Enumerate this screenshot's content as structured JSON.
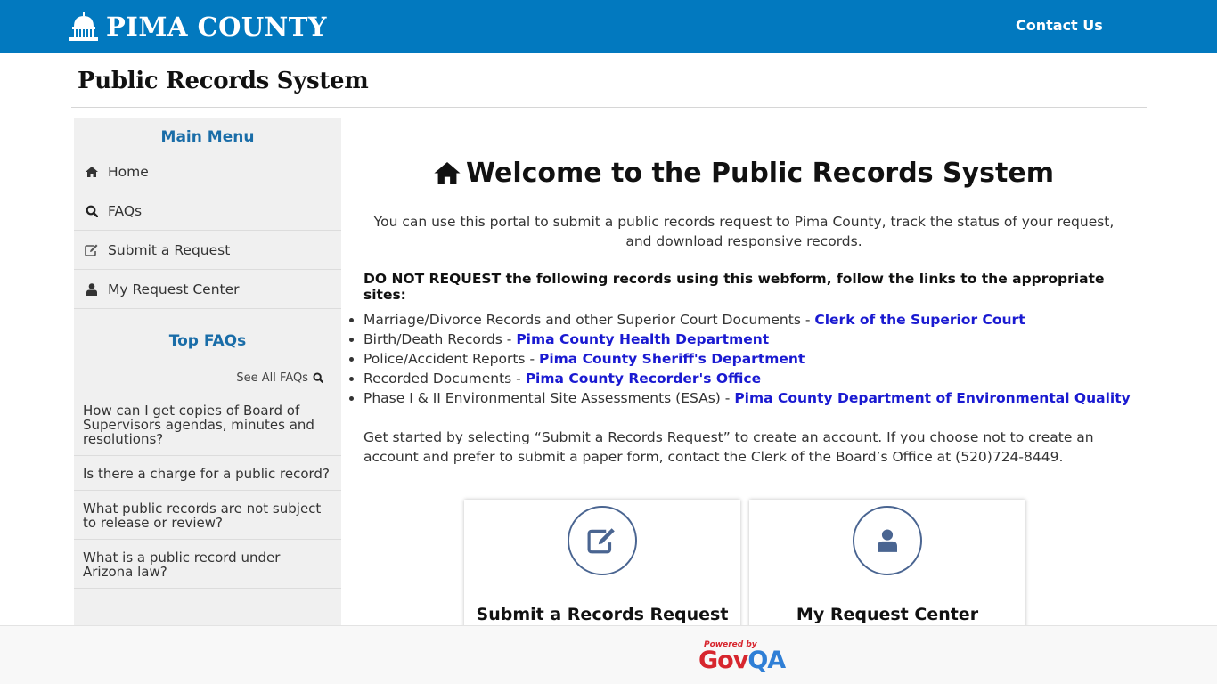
{
  "header": {
    "logo_text": "PIMA COUNTY",
    "logo_icon": "capitol-dome-icon",
    "contact_label": "Contact Us",
    "brand_color": "#0279bf"
  },
  "page": {
    "title": "Public Records System"
  },
  "sidebar": {
    "main_menu_heading": "Main Menu",
    "items": [
      {
        "label": "Home",
        "icon": "home-icon"
      },
      {
        "label": "FAQs",
        "icon": "search-icon"
      },
      {
        "label": "Submit a Request",
        "icon": "edit-icon"
      },
      {
        "label": "My Request Center",
        "icon": "user-icon"
      }
    ],
    "top_faqs_heading": "Top FAQs",
    "see_all_label": "See All FAQs",
    "faqs": [
      "How can I get copies of Board of Supervisors agendas, minutes and resolutions?",
      "Is there a charge for a public record?",
      "What public records are not subject to release or review?",
      "What is a public record under Arizona law?"
    ]
  },
  "main": {
    "welcome_title": "Welcome to the Public Records System",
    "intro": "You can use this portal to submit a public records request to Pima County, track the status of your request, and download responsive records.",
    "warning": "DO NOT REQUEST the following records using this webform, follow the links to the appropriate sites:",
    "records": [
      {
        "text": "Marriage/Divorce Records and other Superior Court Documents - ",
        "link": "Clerk of the Superior Court"
      },
      {
        "text": "Birth/Death Records - ",
        "link": "Pima County Health Department"
      },
      {
        "text": "Police/Accident Reports - ",
        "link": "Pima County Sheriff's Department"
      },
      {
        "text": "Recorded Documents - ",
        "link": "Pima County Recorder's Office"
      },
      {
        "text": "Phase I & II Environmental Site Assessments (ESAs) - ",
        "link": "Pima County Department of Environmental Quality"
      }
    ],
    "get_started": "Get started by selecting “Submit a Records Request” to create an account. If you choose not to create an account and prefer to submit a paper form, contact the Clerk of the Board’s Office at (520)724-8449.",
    "cards": [
      {
        "label": "Submit a Records Request",
        "icon": "edit-icon"
      },
      {
        "label": "My Request Center",
        "icon": "user-icon"
      }
    ],
    "link_color": "#1a1ad1"
  },
  "footer": {
    "powered_by": "Powered by",
    "brand_gov": "Gov",
    "brand_qa": "QA"
  }
}
